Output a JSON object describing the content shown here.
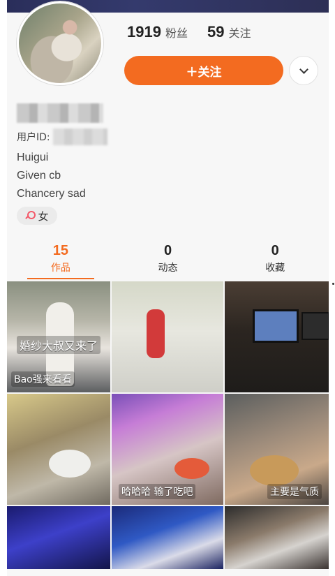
{
  "profile": {
    "followers_count": "1919",
    "followers_label": "粉丝",
    "following_count": "59",
    "following_label": "关注",
    "follow_button_label": "＋关注",
    "user_id_label": "用户ID:",
    "bio_lines": [
      "Huigui",
      "Given cb",
      "Chancery sad"
    ],
    "gender": "女"
  },
  "tabs": [
    {
      "count": "15",
      "label": "作品",
      "active": true
    },
    {
      "count": "0",
      "label": "动态",
      "active": false
    },
    {
      "count": "0",
      "label": "收藏",
      "active": false
    }
  ],
  "grid": {
    "captions": {
      "c1_mid": "婚纱大叔又来了",
      "c1_bottom": "Bao强来看看",
      "c5_bottom": "哈哈哈 输了吃吧",
      "c6_bottom": "主要是气质"
    }
  },
  "colors": {
    "accent": "#f36b20"
  }
}
